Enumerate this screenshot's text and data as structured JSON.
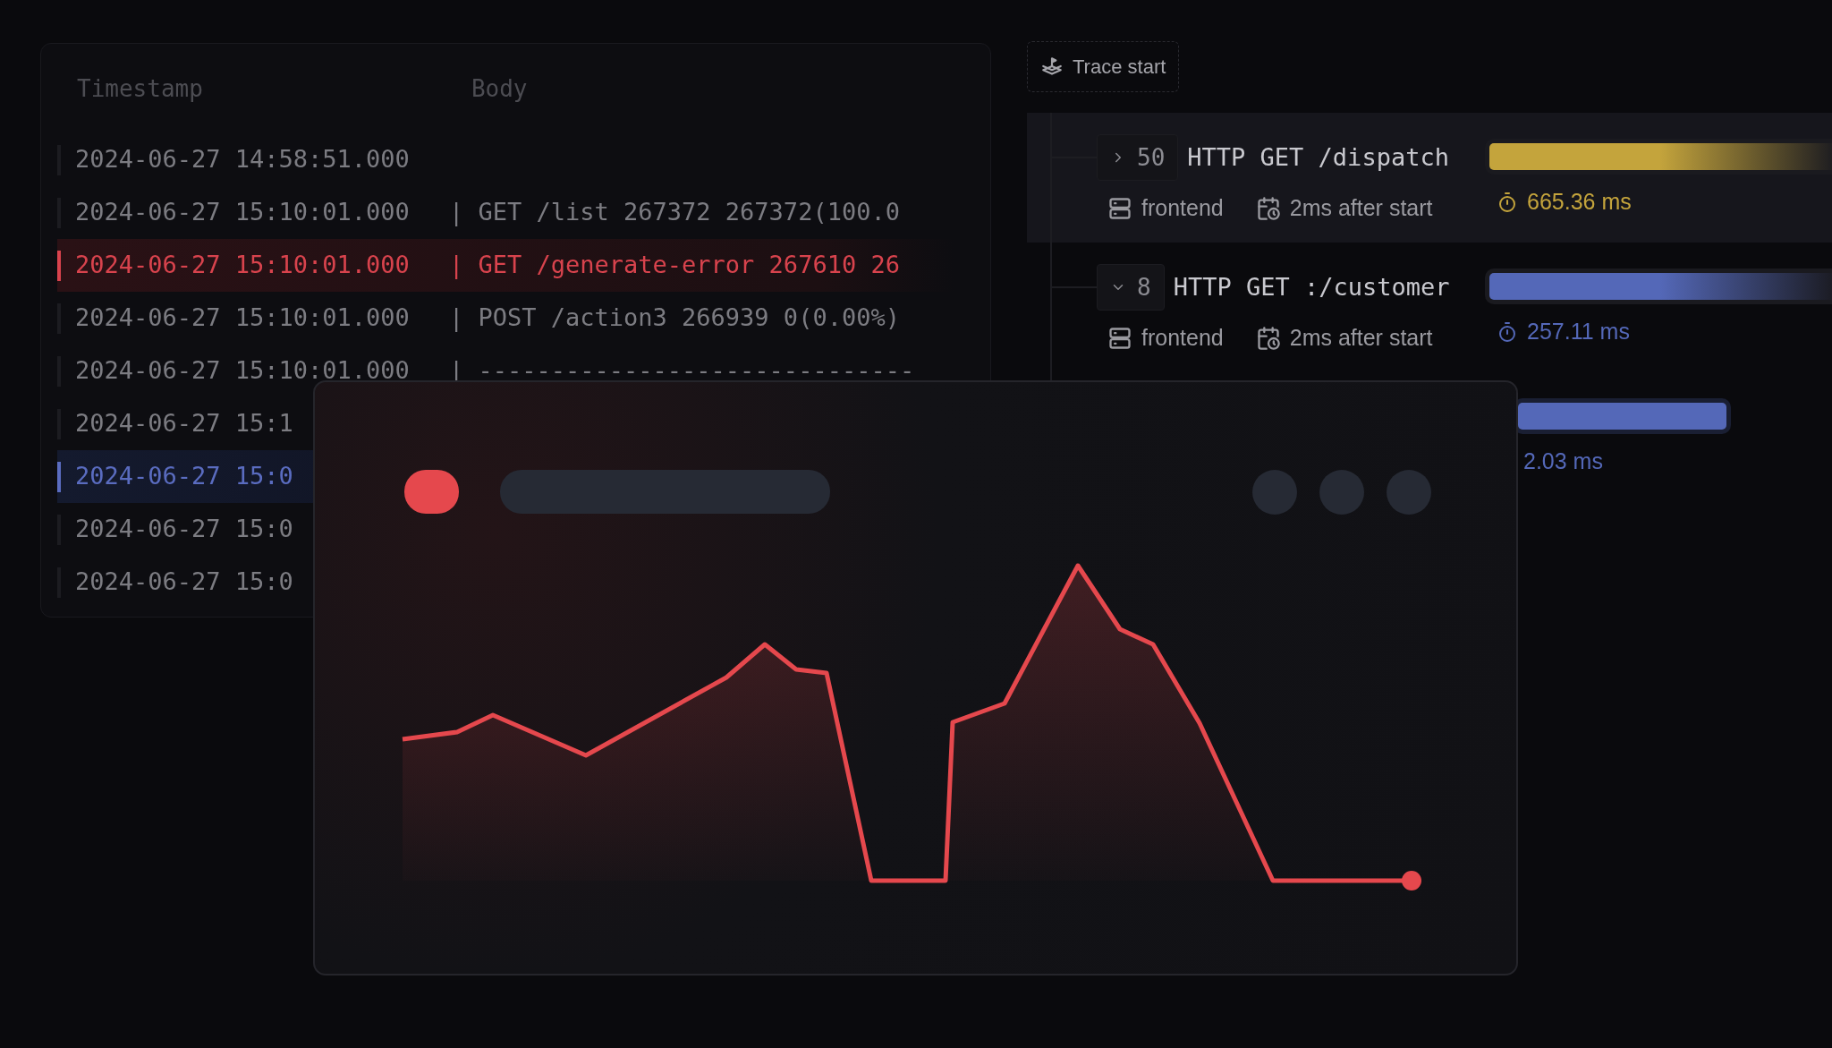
{
  "log_table": {
    "columns": [
      "Timestamp",
      "Body"
    ],
    "rows": [
      {
        "kind": "default",
        "timestamp": "2024-06-27 14:58:51.000"
      },
      {
        "kind": "default",
        "timestamp": "2024-06-27 15:10:01.000",
        "body": "| GET /list 267372 267372(100.0"
      },
      {
        "kind": "error",
        "timestamp": "2024-06-27 15:10:01.000",
        "body": "| GET /generate-error 267610 26"
      },
      {
        "kind": "default",
        "timestamp": "2024-06-27 15:10:01.000",
        "body": "| POST /action3 266939 0(0.00%)"
      },
      {
        "kind": "default",
        "timestamp": "2024-06-27 15:10:01.000",
        "body": "| ------------------------------"
      },
      {
        "kind": "default",
        "timestamp": "2024-06-27 15:1"
      },
      {
        "kind": "info",
        "timestamp": "2024-06-27 15:0"
      },
      {
        "kind": "default",
        "timestamp": "2024-06-27 15:0"
      },
      {
        "kind": "default",
        "timestamp": "2024-06-27 15:0"
      }
    ]
  },
  "trace": {
    "start_label": "Trace start",
    "spans": [
      {
        "selected": true,
        "expanded": false,
        "count": "50",
        "title": "HTTP GET /dispatch",
        "service": "frontend",
        "offset": "2ms after start",
        "duration": "665.36 ms",
        "color": "#c4a43c"
      },
      {
        "selected": false,
        "expanded": true,
        "count": "8",
        "title": "HTTP GET :/customer",
        "service": "frontend",
        "offset": "2ms after start",
        "duration": "257.11 ms",
        "color": "#5468b8"
      },
      {
        "selected": false,
        "duration": "2.03 ms",
        "color": "#5468b8"
      }
    ]
  },
  "chart_card": {
    "kind": "line-skeleton"
  }
}
